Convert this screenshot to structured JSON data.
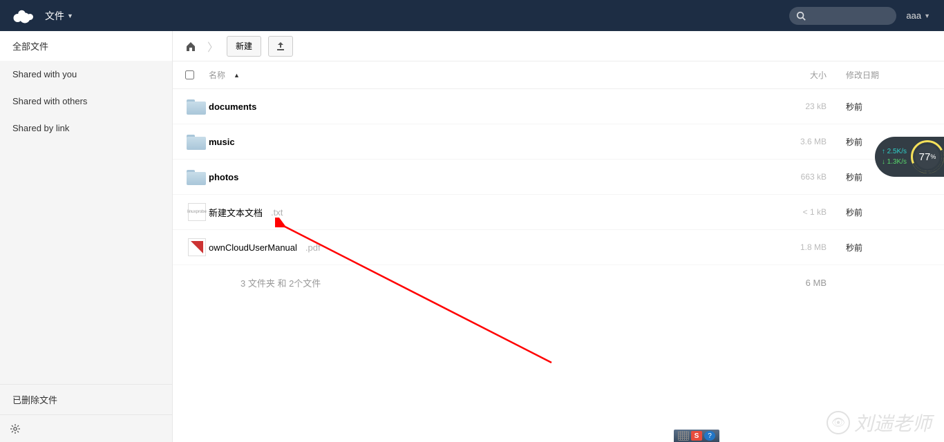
{
  "header": {
    "app_name": "文件",
    "user_name": "aaa"
  },
  "sidebar": {
    "items": [
      {
        "label": "全部文件",
        "active": true
      },
      {
        "label": "Shared with you",
        "active": false
      },
      {
        "label": "Shared with others",
        "active": false
      },
      {
        "label": "Shared by link",
        "active": false
      }
    ],
    "deleted_label": "已删除文件"
  },
  "controls": {
    "new_button": "新建"
  },
  "columns": {
    "name": "名称",
    "size": "大小",
    "date": "修改日期"
  },
  "files": [
    {
      "type": "folder",
      "name": "documents",
      "ext": "",
      "size": "23 kB",
      "date": "秒前"
    },
    {
      "type": "folder",
      "name": "music",
      "ext": "",
      "size": "3.6 MB",
      "date": "秒前"
    },
    {
      "type": "folder",
      "name": "photos",
      "ext": "",
      "size": "663 kB",
      "date": "秒前"
    },
    {
      "type": "txt",
      "name": "新建文本文档",
      "ext": ".txt",
      "size": "< 1 kB",
      "date": "秒前"
    },
    {
      "type": "pdf",
      "name": "ownCloudUserManual",
      "ext": ".pdf",
      "size": "1.8 MB",
      "date": "秒前"
    }
  ],
  "summary": {
    "text": "3 文件夹 和 2个文件",
    "size": "6 MB"
  },
  "speed_widget": {
    "up": "2.5K/s",
    "down": "1.3K/s",
    "percent": "77",
    "unit": "%"
  },
  "watermark": "刘遄老师",
  "taskbar": {
    "s": "S",
    "q": "?"
  }
}
